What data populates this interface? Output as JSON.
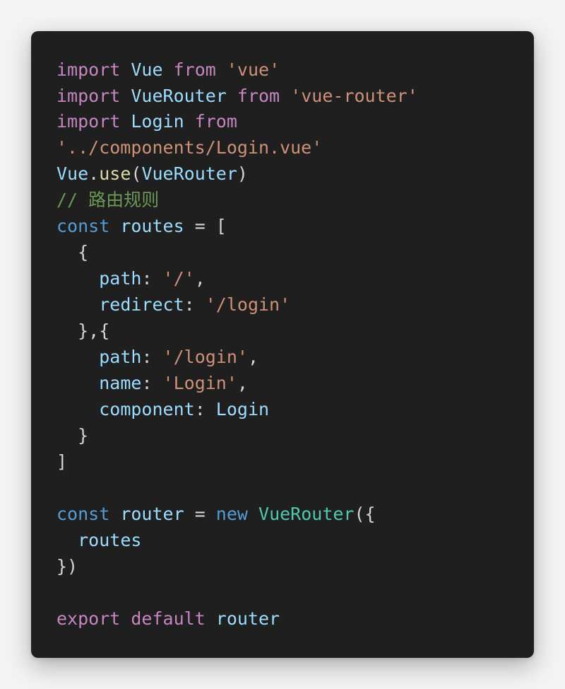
{
  "colors": {
    "page_background": "#f3f3f3",
    "editor_background": "#1f1f1f",
    "keyword_control": "#c586c0",
    "keyword_storage": "#569cd6",
    "variable": "#9cdcfe",
    "string": "#ce9178",
    "function": "#dcdcaa",
    "class": "#4ec9b0",
    "plain": "#d4d4d4",
    "comment": "#6a9955"
  },
  "code": {
    "lines": [
      [
        {
          "t": "import",
          "c": "kw"
        },
        {
          "t": " ",
          "c": "plain"
        },
        {
          "t": "Vue",
          "c": "var"
        },
        {
          "t": " ",
          "c": "plain"
        },
        {
          "t": "from",
          "c": "kw"
        },
        {
          "t": " ",
          "c": "plain"
        },
        {
          "t": "'vue'",
          "c": "str"
        }
      ],
      [
        {
          "t": "import",
          "c": "kw"
        },
        {
          "t": " ",
          "c": "plain"
        },
        {
          "t": "VueRouter",
          "c": "var"
        },
        {
          "t": " ",
          "c": "plain"
        },
        {
          "t": "from",
          "c": "kw"
        },
        {
          "t": " ",
          "c": "plain"
        },
        {
          "t": "'vue-router'",
          "c": "str"
        }
      ],
      [
        {
          "t": "import",
          "c": "kw"
        },
        {
          "t": " ",
          "c": "plain"
        },
        {
          "t": "Login",
          "c": "var"
        },
        {
          "t": " ",
          "c": "plain"
        },
        {
          "t": "from",
          "c": "kw"
        }
      ],
      [
        {
          "t": "'../components/Login.vue'",
          "c": "str"
        }
      ],
      [
        {
          "t": "Vue",
          "c": "var"
        },
        {
          "t": ".",
          "c": "plain"
        },
        {
          "t": "use",
          "c": "fn"
        },
        {
          "t": "(",
          "c": "plain"
        },
        {
          "t": "VueRouter",
          "c": "var"
        },
        {
          "t": ")",
          "c": "plain"
        }
      ],
      [
        {
          "t": "// 路由规则",
          "c": "cmt"
        }
      ],
      [
        {
          "t": "const",
          "c": "kw2"
        },
        {
          "t": " ",
          "c": "plain"
        },
        {
          "t": "routes",
          "c": "var"
        },
        {
          "t": " = [",
          "c": "plain"
        }
      ],
      [
        {
          "t": "  {",
          "c": "plain"
        }
      ],
      [
        {
          "t": "    ",
          "c": "plain"
        },
        {
          "t": "path",
          "c": "var"
        },
        {
          "t": ": ",
          "c": "plain"
        },
        {
          "t": "'/'",
          "c": "str"
        },
        {
          "t": ",",
          "c": "plain"
        }
      ],
      [
        {
          "t": "    ",
          "c": "plain"
        },
        {
          "t": "redirect",
          "c": "var"
        },
        {
          "t": ": ",
          "c": "plain"
        },
        {
          "t": "'/login'",
          "c": "str"
        }
      ],
      [
        {
          "t": "  },{",
          "c": "plain"
        }
      ],
      [
        {
          "t": "    ",
          "c": "plain"
        },
        {
          "t": "path",
          "c": "var"
        },
        {
          "t": ": ",
          "c": "plain"
        },
        {
          "t": "'/login'",
          "c": "str"
        },
        {
          "t": ",",
          "c": "plain"
        }
      ],
      [
        {
          "t": "    ",
          "c": "plain"
        },
        {
          "t": "name",
          "c": "var"
        },
        {
          "t": ": ",
          "c": "plain"
        },
        {
          "t": "'Login'",
          "c": "str"
        },
        {
          "t": ",",
          "c": "plain"
        }
      ],
      [
        {
          "t": "    ",
          "c": "plain"
        },
        {
          "t": "component",
          "c": "var"
        },
        {
          "t": ": ",
          "c": "plain"
        },
        {
          "t": "Login",
          "c": "var"
        }
      ],
      [
        {
          "t": "  }",
          "c": "plain"
        }
      ],
      [
        {
          "t": "]",
          "c": "plain"
        }
      ],
      [],
      [
        {
          "t": "const",
          "c": "kw2"
        },
        {
          "t": " ",
          "c": "plain"
        },
        {
          "t": "router",
          "c": "var"
        },
        {
          "t": " = ",
          "c": "plain"
        },
        {
          "t": "new",
          "c": "kw2"
        },
        {
          "t": " ",
          "c": "plain"
        },
        {
          "t": "VueRouter",
          "c": "cls"
        },
        {
          "t": "({",
          "c": "plain"
        }
      ],
      [
        {
          "t": "  ",
          "c": "plain"
        },
        {
          "t": "routes",
          "c": "var"
        }
      ],
      [
        {
          "t": "})",
          "c": "plain"
        }
      ],
      [],
      [
        {
          "t": "export",
          "c": "kw"
        },
        {
          "t": " ",
          "c": "plain"
        },
        {
          "t": "default",
          "c": "kw"
        },
        {
          "t": " ",
          "c": "plain"
        },
        {
          "t": "router",
          "c": "var"
        }
      ]
    ]
  }
}
